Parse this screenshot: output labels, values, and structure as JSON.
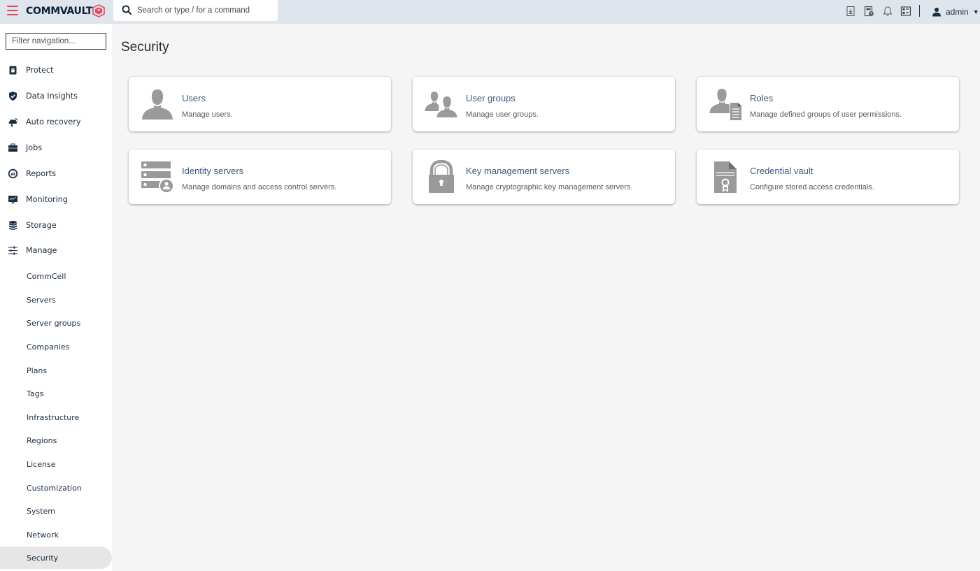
{
  "header": {
    "brand": "COMMVAULT",
    "search_placeholder": "Search or type / for a command",
    "user_name": "admin",
    "icons": [
      "download-report-icon",
      "scheduled-report-icon",
      "notifications-bell-icon",
      "dashboard-grid-icon"
    ],
    "accent_color": "#e8455c"
  },
  "sidebar": {
    "filter_placeholder": "Filter navigation...",
    "items": [
      {
        "label": "Protect",
        "icon": "protect-shield-lock-icon"
      },
      {
        "label": "Data Insights",
        "icon": "shield-check-icon"
      },
      {
        "label": "Auto recovery",
        "icon": "cloud-recovery-icon"
      },
      {
        "label": "Jobs",
        "icon": "briefcase-icon"
      },
      {
        "label": "Reports",
        "icon": "report-gauge-icon"
      },
      {
        "label": "Monitoring",
        "icon": "monitor-chart-icon"
      },
      {
        "label": "Storage",
        "icon": "database-icon"
      },
      {
        "label": "Manage",
        "icon": "sliders-icon"
      }
    ],
    "manage_subitems": [
      {
        "label": "CommCell"
      },
      {
        "label": "Servers"
      },
      {
        "label": "Server groups"
      },
      {
        "label": "Companies"
      },
      {
        "label": "Plans"
      },
      {
        "label": "Tags"
      },
      {
        "label": "Infrastructure"
      },
      {
        "label": "Regions"
      },
      {
        "label": "License"
      },
      {
        "label": "Customization"
      },
      {
        "label": "System"
      },
      {
        "label": "Network"
      },
      {
        "label": "Security",
        "active": true
      }
    ]
  },
  "main": {
    "title": "Security",
    "cards": [
      {
        "title": "Users",
        "description": "Manage users.",
        "icon": "user-icon"
      },
      {
        "title": "User groups",
        "description": "Manage user groups.",
        "icon": "user-group-icon"
      },
      {
        "title": "Roles",
        "description": "Manage defined groups of user permissions.",
        "icon": "role-user-document-icon"
      },
      {
        "title": "Identity servers",
        "description": "Manage domains and access control servers.",
        "icon": "server-user-icon"
      },
      {
        "title": "Key management servers",
        "description": "Manage cryptographic key management servers.",
        "icon": "padlock-icon"
      },
      {
        "title": "Credential vault",
        "description": "Configure stored access credentials.",
        "icon": "certificate-document-icon"
      }
    ]
  }
}
